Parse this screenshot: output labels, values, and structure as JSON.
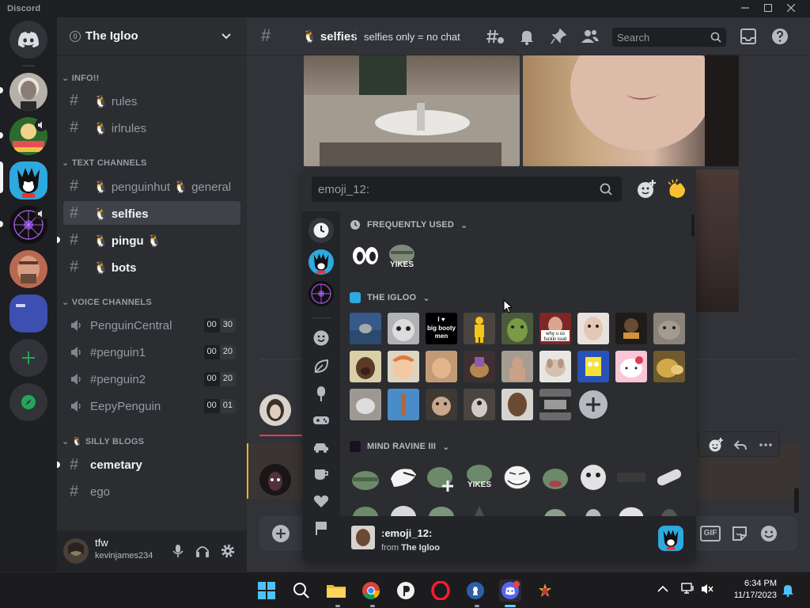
{
  "window": {
    "title": "Discord",
    "controls": [
      "minimize-icon",
      "maximize-icon",
      "close-icon"
    ]
  },
  "servers": [
    {
      "name": "Direct Messages",
      "icon": "discord-icon"
    },
    {
      "name": "server-1",
      "color": "#c7c2bd"
    },
    {
      "name": "server-2",
      "color": "#3c8a3c"
    },
    {
      "name": "The Igloo",
      "color": "#2ea9e0",
      "selected": true
    },
    {
      "name": "Mind Ravine III",
      "color": "#141414"
    },
    {
      "name": "server-5",
      "color": "#9e5a4a"
    },
    {
      "name": "server-6",
      "color": "#3d4fb0"
    },
    {
      "name": "Add a Server",
      "icon": "plus-icon"
    },
    {
      "name": "Explore",
      "icon": "compass-icon"
    }
  ],
  "guild": {
    "name": "The Igloo",
    "boost_badge": "0"
  },
  "categories": [
    {
      "label": "INFO!!",
      "channels": [
        {
          "name": "🐧 rules"
        },
        {
          "name": "🐧 irlrules"
        }
      ]
    },
    {
      "label": "TEXT CHANNELS",
      "channels": [
        {
          "name": "🐧 penguinhut 🐧 general"
        },
        {
          "name": "🐧 selfies",
          "selected": true
        },
        {
          "name": "🐧 pingu 🐧"
        },
        {
          "name": "🐧 bots"
        }
      ]
    },
    {
      "label": "VOICE CHANNELS",
      "channels": [
        {
          "name": "PenguinCentral",
          "count": "00",
          "limit": "30"
        },
        {
          "name": "#penguin1",
          "count": "00",
          "limit": "20"
        },
        {
          "name": "#penguin2",
          "count": "00",
          "limit": "20"
        },
        {
          "name": "EepyPenguin",
          "count": "00",
          "limit": "01"
        }
      ]
    },
    {
      "label": "🐧 SILLY BLOGS",
      "channels": [
        {
          "name": "cemetary"
        },
        {
          "name": "ego"
        }
      ]
    }
  ],
  "user": {
    "display_name": "tfw",
    "username": "kevinjames234"
  },
  "header": {
    "channel": "🐧 selfies",
    "topic": "selfies only = no chat",
    "search_placeholder": "Search"
  },
  "picker": {
    "search_value": "",
    "search_placeholder": "emoji_12:",
    "sections": [
      {
        "title": "FREQUENTLY USED",
        "icon": "clock-icon"
      },
      {
        "title": "THE IGLOO",
        "icon": "server-icon"
      },
      {
        "title": "MIND RAVINE III",
        "icon": "server-icon"
      }
    ],
    "frequent_caption": "YIKES",
    "igloo_captions": {
      "heart_label": "I ♥",
      "booty_label": "big booty men",
      "fuckin_label": "why u so fuckin loud"
    },
    "ravine_captions": {
      "yikes_label": "YIKES"
    },
    "footer": {
      "name": ":emoji_12:",
      "from_prefix": "from",
      "from_server": "The Igloo"
    },
    "rail_icons": [
      "clock-icon",
      "igloo-server-icon",
      "ravine-server-icon",
      "smile-icon",
      "leaf-icon",
      "popsicle-icon",
      "gamepad-icon",
      "car-icon",
      "cup-icon",
      "heart-icon",
      "flag-icon"
    ]
  },
  "composer": {
    "buttons": [
      "plus-icon",
      "gif-button",
      "sticker-icon",
      "emoji-icon"
    ],
    "gif_label": "GIF"
  },
  "hover_actions": [
    "add-reaction-icon",
    "reply-icon",
    "more-icon"
  ],
  "taskbar": {
    "apps": [
      "windows-start-icon",
      "search-icon",
      "file-explorer-icon",
      "chrome-icon",
      "pandora-icon",
      "opera-icon",
      "chess-icon",
      "discord-icon",
      "game-icon"
    ],
    "time": "6:34 PM",
    "date": "11/17/2023"
  }
}
